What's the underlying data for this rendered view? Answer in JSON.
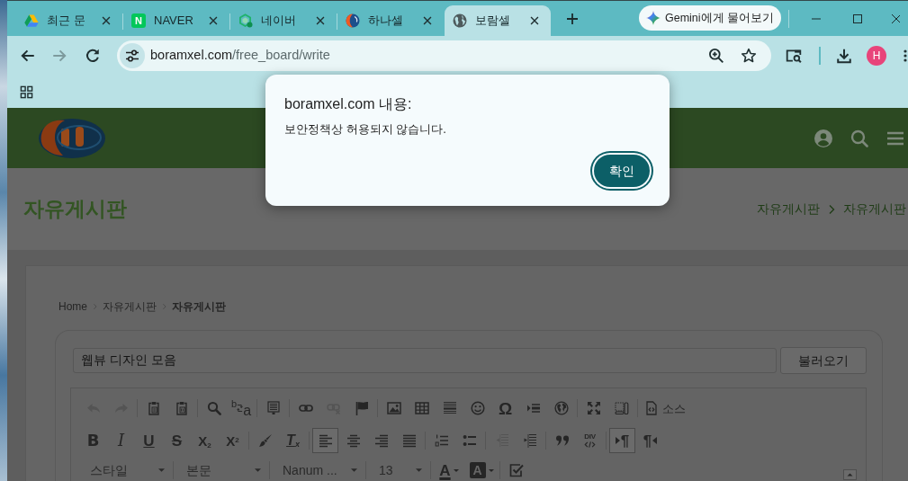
{
  "browser": {
    "tabs": [
      {
        "title": "최근 문",
        "selected": false
      },
      {
        "title": "NAVER",
        "selected": false,
        "favicon_letter": "N"
      },
      {
        "title": "네이버",
        "selected": false
      },
      {
        "title": "하나셀",
        "selected": false
      },
      {
        "title": "보람셀",
        "selected": true
      }
    ],
    "assistant_button": "Gemini에게 물어보기",
    "nav_buttons": [
      {
        "disabled": false
      },
      {
        "disabled": true
      },
      {
        "disabled": false
      }
    ],
    "address": {
      "host": "boramxel.com",
      "path": "/free_board/write"
    },
    "profile_initial": "H"
  },
  "page_header": {
    "title": "자유게시판",
    "trail": [
      "자유게시판",
      "자유게시판"
    ]
  },
  "breadcrumb": [
    {
      "label": "Home",
      "current": false
    },
    {
      "label": "자유게시판",
      "current": false
    },
    {
      "label": "자유게시판",
      "current": true
    }
  ],
  "post_form": {
    "title_value": "웹뷰 디자인 모음",
    "load_button": "불러오기"
  },
  "editor_toolbar": {
    "rows": [
      {
        "groups": [
          {
            "items": [
              {
                "kind": "button",
                "disabled": true
              },
              {
                "kind": "button",
                "disabled": true
              }
            ]
          },
          {
            "items": [
              {
                "kind": "button",
                "disabled": false
              },
              {
                "kind": "button",
                "disabled": false
              }
            ]
          },
          {
            "items": [
              {
                "kind": "button",
                "disabled": false
              },
              {
                "kind": "button",
                "disabled": false,
                "glyphs": [
                  "b",
                  "a"
                ]
              }
            ]
          },
          {
            "items": [
              {
                "kind": "button",
                "disabled": false
              }
            ]
          },
          {
            "items": [
              {
                "kind": "button",
                "disabled": false
              },
              {
                "kind": "button",
                "disabled": true
              },
              {
                "kind": "button",
                "disabled": false
              }
            ]
          },
          {
            "items": [
              {
                "kind": "button",
                "disabled": false
              },
              {
                "kind": "button",
                "disabled": false
              },
              {
                "kind": "button",
                "disabled": false
              },
              {
                "kind": "button",
                "disabled": false
              },
              {
                "kind": "button",
                "disabled": false,
                "text": "Ω"
              },
              {
                "kind": "button",
                "disabled": false
              },
              {
                "kind": "button",
                "disabled": false
              }
            ]
          },
          {
            "items": [
              {
                "kind": "button",
                "disabled": false
              },
              {
                "kind": "button",
                "disabled": false
              }
            ]
          },
          {
            "items": [
              {
                "kind": "button",
                "disabled": false,
                "text": "소스"
              }
            ]
          }
        ]
      },
      {
        "groups": [
          {
            "items": [
              {
                "kind": "button",
                "disabled": false,
                "on": false,
                "text": "B"
              },
              {
                "kind": "button",
                "disabled": false,
                "on": false,
                "text": "I"
              },
              {
                "kind": "button",
                "disabled": false,
                "on": false,
                "text": "U"
              },
              {
                "kind": "button",
                "disabled": false,
                "on": false,
                "text": "S"
              },
              {
                "kind": "button",
                "disabled": false,
                "on": false,
                "text": "X$_{2}$"
              },
              {
                "kind": "button",
                "disabled": false,
                "on": false,
                "text": "X$^{2}$"
              }
            ]
          },
          {
            "items": [
              {
                "kind": "button",
                "disabled": false,
                "on": false
              },
              {
                "kind": "button",
                "disabled": false,
                "on": false,
                "text": "T$_{x}$"
              }
            ]
          },
          {
            "items": [
              {
                "kind": "button",
                "disabled": false,
                "on": true
              },
              {
                "kind": "button",
                "disabled": false,
                "on": false
              },
              {
                "kind": "button",
                "disabled": false,
                "on": false
              },
              {
                "kind": "button",
                "disabled": false,
                "on": false
              }
            ]
          },
          {
            "items": [
              {
                "kind": "button",
                "disabled": false,
                "on": false
              },
              {
                "kind": "button",
                "disabled": false,
                "on": false
              }
            ]
          },
          {
            "items": [
              {
                "kind": "button",
                "disabled": true,
                "on": false
              },
              {
                "kind": "button",
                "disabled": false,
                "on": false
              }
            ]
          },
          {
            "items": [
              {
                "kind": "button",
                "disabled": false,
                "on": false
              },
              {
                "kind": "button",
                "disabled": false,
                "on": false,
                "text": "DIV"
              }
            ]
          },
          {
            "items": [
              {
                "kind": "button",
                "disabled": false,
                "on": true,
                "text": "¶"
              },
              {
                "kind": "button",
                "disabled": false,
                "on": false,
                "text": "¶"
              }
            ]
          }
        ]
      },
      {
        "groups": [
          {
            "items": [
              {
                "kind": "dropdown",
                "value": "스타일"
              }
            ]
          },
          {
            "items": [
              {
                "kind": "dropdown",
                "value": "본문"
              }
            ]
          },
          {
            "items": [
              {
                "kind": "dropdown",
                "value": "Nanum ..."
              }
            ]
          },
          {
            "items": [
              {
                "kind": "dropdown",
                "value": "13"
              }
            ]
          },
          {
            "items": [
              {
                "kind": "forecolor",
                "text": "A"
              },
              {
                "kind": "backcolor",
                "text": "A"
              }
            ]
          },
          {
            "items": [
              {
                "kind": "button",
                "disabled": false
              }
            ]
          }
        ]
      }
    ]
  },
  "dialog": {
    "title": "boramxel.com 내용:",
    "message": "보안정책상 허용되지 않습니다.",
    "ok_button": "확인"
  }
}
